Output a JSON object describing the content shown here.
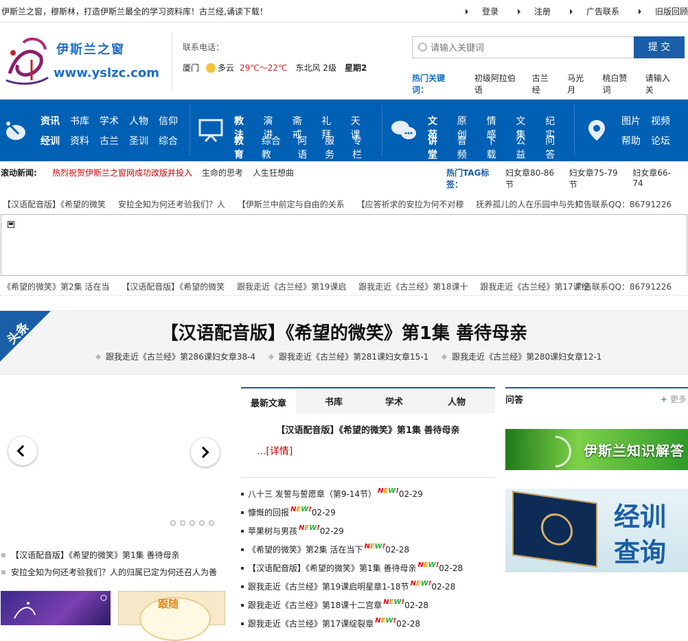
{
  "top": {
    "slogan": "伊斯兰之窗，穆斯林，打造伊斯兰最全的学习资料库！古兰经,诵读下载！",
    "links": [
      "登录",
      "注册",
      "广告联系",
      "旧版回顾"
    ]
  },
  "logo": {
    "cn": "伊斯兰之窗",
    "url": "www.yslzc.com"
  },
  "contact": {
    "label": "联系电话："
  },
  "weather": {
    "city": "厦门",
    "cond": "多云",
    "temp": "29℃～22℃",
    "wind": "东北风  2级",
    "week": "星期2"
  },
  "search": {
    "placeholder": "请输入关键词",
    "button": "提 交"
  },
  "hot_keywords": {
    "label": "热门关键词：",
    "items": [
      "初级阿拉伯语",
      "古兰经",
      "马光月",
      "桃白赞词",
      "请输入关"
    ]
  },
  "nav": {
    "g1": {
      "row1": [
        "资讯",
        "书库",
        "学术",
        "人物",
        "信仰"
      ],
      "row2": [
        "经训",
        "资料",
        "古兰",
        "圣训",
        "综合"
      ]
    },
    "g2": {
      "row1": [
        "教法",
        "演讲",
        "斋戒",
        "礼拜",
        "天课"
      ],
      "row2": [
        "教育",
        "综合教",
        "阿语",
        "服务",
        "专栏"
      ]
    },
    "g3": {
      "row1": [
        "文苑",
        "原创",
        "情感",
        "文集",
        "纪实"
      ],
      "row2": [
        "讲堂",
        "音频",
        "下载",
        "公益",
        "问答"
      ]
    },
    "g4": {
      "row1": [
        "图片",
        "视频"
      ],
      "row2": [
        "帮助",
        "论坛"
      ]
    }
  },
  "scrolling": {
    "label": "滚动新闻:",
    "items": [
      "热烈祝贺伊斯兰之窗网成功改版并投入",
      "生命的思考",
      "人生狂想曲"
    ],
    "tag_label": "热门TAG标签：",
    "tags": [
      "妇女章80-86节",
      "妇女章75-79节",
      "妇女章66-74"
    ]
  },
  "ticker1": {
    "items": [
      "【汉语配音版】《希望的微笑",
      "安拉全知为何还考验我们？人",
      "【伊斯兰中前定与自由的关系",
      "【应答祈求的安拉为何不对穆",
      "抚养孤儿的人在乐园中与先知"
    ],
    "ad": "广告联系QQ：86791226"
  },
  "ticker2": {
    "items": [
      "《希望的微笑》第2集 活在当",
      "【汉语配音版】《希望的微笑",
      "跟我走近《古兰经》第19课启",
      "跟我走近《古兰经》第18课十",
      "跟我走近《古兰经》第17课绽"
    ],
    "ad": "广告联系QQ：86791226"
  },
  "headline": {
    "badge": "头条",
    "title": "【汉语配音版】《希望的微笑》第1集 善待母亲",
    "subs": [
      "跟我走近《古兰经》第286课妇女章38-4",
      "跟我走近《古兰经》第281课妇女章15-1",
      "跟我走近《古兰经》第280课妇女章12-1"
    ]
  },
  "left_list": [
    "【汉语配音版】《希望的微笑》第1集 善待母亲",
    "安拉全知为何还考验我们？人的归属已定为何还召人为善"
  ],
  "left_thumbs": {
    "t2_text": "跟随"
  },
  "tabs": [
    "最新文章",
    "书库",
    "学术",
    "人物"
  ],
  "featured": {
    "title": "【汉语配音版】《希望的微笑》第1集 善待母亲",
    "dots": "...",
    "detail": "[详情]"
  },
  "articles": [
    {
      "title": "八十三 发誓与誓愿章（第9-14节）",
      "date": "02-29"
    },
    {
      "title": "慷慨的回报",
      "date": "02-29"
    },
    {
      "title": "苹果树与男孩",
      "date": "02-29"
    },
    {
      "title": "《希望的微笑》第2集 活在当下",
      "date": "02-28"
    },
    {
      "title": "【汉语配音版】《希望的微笑》第1集 善待母亲",
      "date": "02-28"
    },
    {
      "title": "跟我走近《古兰经》第19课启明星章1-18节",
      "date": "02-28"
    },
    {
      "title": "跟我走近《古兰经》第18课十二宫章",
      "date": "02-28"
    },
    {
      "title": "跟我走近《古兰经》第17课绽裂章",
      "date": "02-28"
    }
  ],
  "new_badge": {
    "n": "N",
    "e": "E",
    "w": "W",
    "x": "!"
  },
  "qa": {
    "title": "问答",
    "more_icon": "+",
    "more": "更多"
  },
  "banners": {
    "b1": "伊斯兰知识解答",
    "b2_line1": "经训",
    "b2_line2": "查询"
  }
}
